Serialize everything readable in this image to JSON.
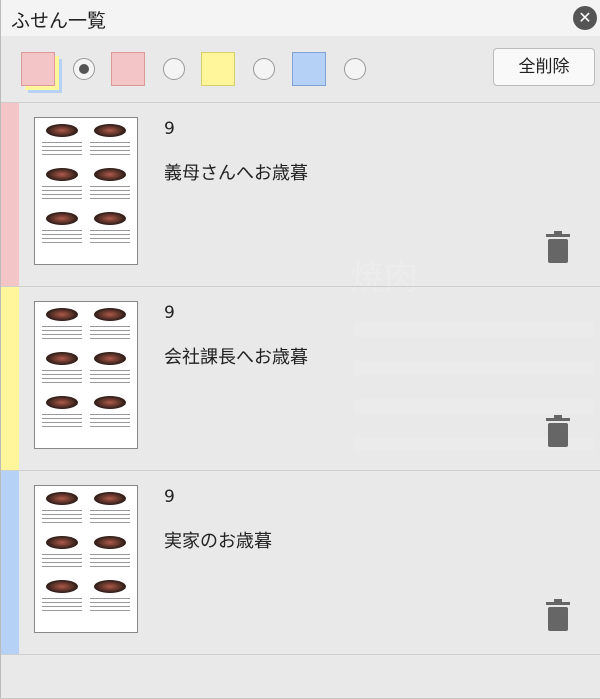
{
  "window": {
    "title": "ふせん一覧"
  },
  "filters": {
    "colors": [
      "#f3c5c7",
      "#fff59a",
      "#b5d2f6"
    ],
    "delete_all_label": "全削除"
  },
  "notes": [
    {
      "page": "9",
      "text": "義母さんへお歳暮",
      "color": "#f3c5c7"
    },
    {
      "page": "9",
      "text": "会社課長へお歳暮",
      "color": "#fff59a"
    },
    {
      "page": "9",
      "text": "実家のお歳暮",
      "color": "#b5d2f6"
    }
  ],
  "background_document": {
    "title": "焼肉"
  }
}
